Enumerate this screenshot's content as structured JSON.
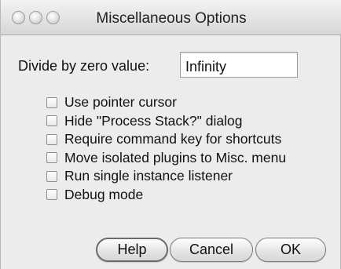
{
  "window": {
    "title": "Miscellaneous Options"
  },
  "divide": {
    "label": "Divide by zero value:",
    "value": "Infinity"
  },
  "options": [
    {
      "label": "Use pointer cursor",
      "checked": false
    },
    {
      "label": "Hide \"Process Stack?\" dialog",
      "checked": false
    },
    {
      "label": "Require command key for shortcuts",
      "checked": false
    },
    {
      "label": "Move isolated plugins to Misc. menu",
      "checked": false
    },
    {
      "label": "Run single instance listener",
      "checked": false
    },
    {
      "label": "Debug mode",
      "checked": false
    }
  ],
  "buttons": {
    "help": "Help",
    "cancel": "Cancel",
    "ok": "OK"
  },
  "icons": {
    "close": "close-icon",
    "minimize": "minimize-icon",
    "zoom": "zoom-icon"
  }
}
